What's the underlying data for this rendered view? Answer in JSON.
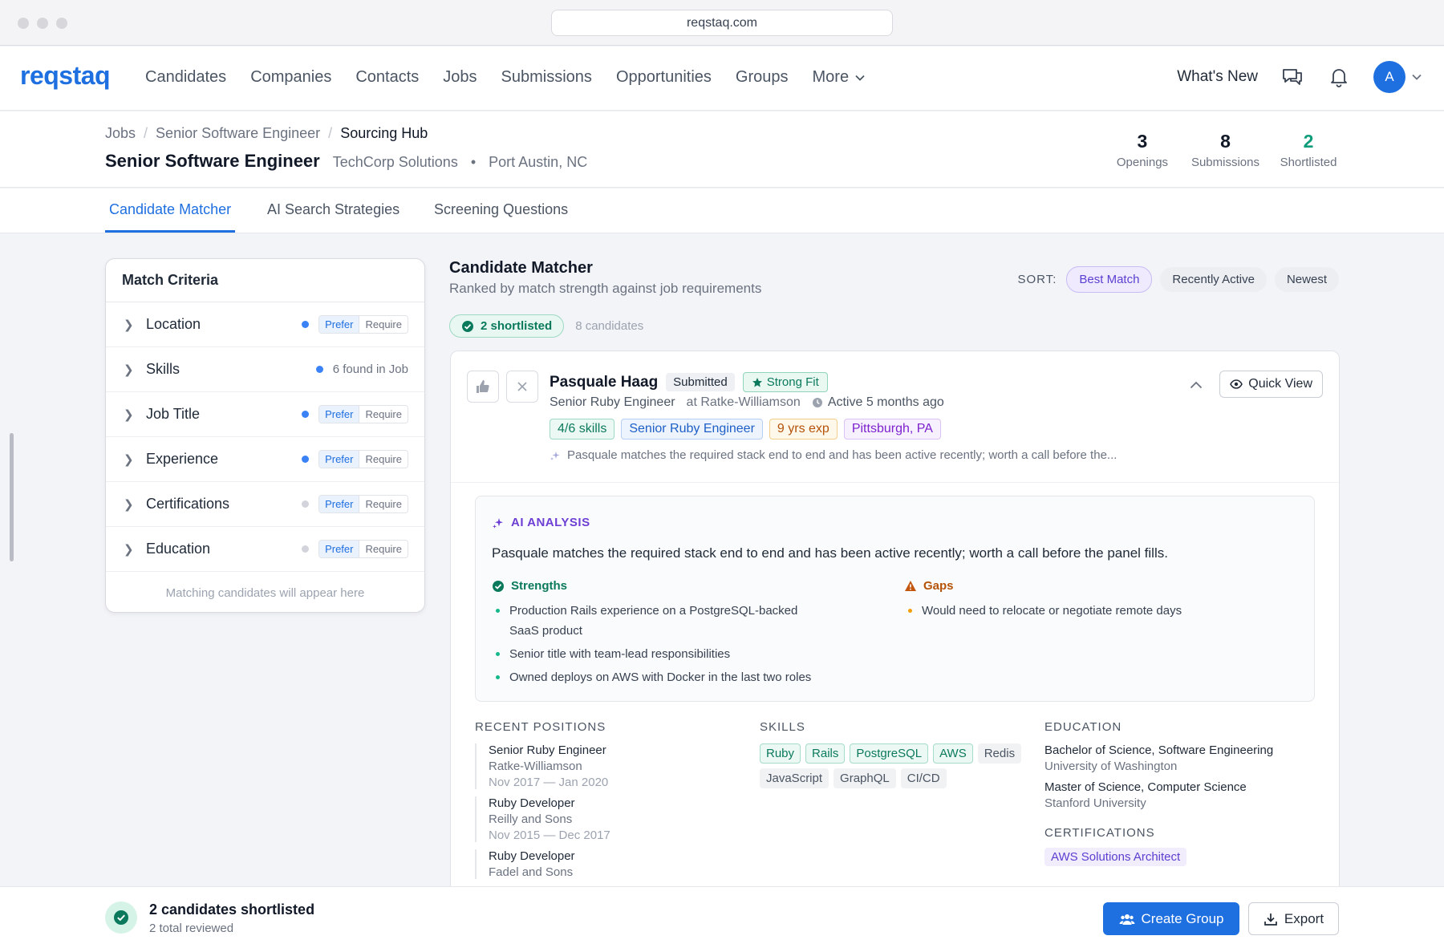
{
  "browser": {
    "url": "reqstaq.com"
  },
  "nav": {
    "logo": "reqstaq",
    "links": [
      "Candidates",
      "Companies",
      "Contacts",
      "Jobs",
      "Submissions",
      "Opportunities",
      "Groups"
    ],
    "more": "More",
    "whats_new": "What's New",
    "avatar_initial": "A"
  },
  "breadcrumb": {
    "jobs": "Jobs",
    "job": "Senior Software Engineer",
    "current": "Sourcing Hub"
  },
  "job": {
    "title": "Senior Software Engineer",
    "company": "TechCorp Solutions",
    "location": "Port Austin, NC"
  },
  "stats": [
    {
      "value": "3",
      "label": "Openings"
    },
    {
      "value": "8",
      "label": "Submissions"
    },
    {
      "value": "2",
      "label": "Shortlisted"
    }
  ],
  "tabs": [
    "Candidate Matcher",
    "AI Search Strategies",
    "Screening Questions"
  ],
  "criteria": {
    "title": "Match Criteria",
    "prefer": "Prefer",
    "require": "Require",
    "rows": [
      {
        "label": "Location"
      },
      {
        "label": "Skills",
        "found": "6 found in Job"
      },
      {
        "label": "Job Title"
      },
      {
        "label": "Experience"
      },
      {
        "label": "Certifications"
      },
      {
        "label": "Education"
      }
    ],
    "footer": "Matching candidates will appear here"
  },
  "matcher": {
    "title": "Candidate Matcher",
    "subtitle": "Ranked by match strength against job requirements",
    "sort_label": "SORT:",
    "sort_options": [
      "Best Match",
      "Recently Active",
      "Newest"
    ],
    "shortlisted": "2 shortlisted",
    "count": "8 candidates"
  },
  "candidate": {
    "name": "Pasquale Haag",
    "status": "Submitted",
    "fit": "Strong Fit",
    "role": "Senior Ruby Engineer",
    "company": "at Ratke-Williamson",
    "active": "Active 5 months ago",
    "tags": [
      "4/6 skills",
      "Senior Ruby Engineer",
      "9 yrs exp",
      "Pittsburgh, PA"
    ],
    "snippet": "Pasquale matches the required stack end to end and has been active recently; worth a call before the...",
    "quick_view": "Quick View",
    "ai": {
      "heading": "AI ANALYSIS",
      "summary": "Pasquale matches the required stack end to end and has been active recently; worth a call before the panel fills.",
      "strengths_label": "Strengths",
      "strengths": [
        "Production Rails experience on a PostgreSQL-backed SaaS product",
        "Senior title with team-lead responsibilities",
        "Owned deploys on AWS with Docker in the last two roles"
      ],
      "gaps_label": "Gaps",
      "gaps": [
        "Would need to relocate or negotiate remote days"
      ]
    },
    "positions_label": "RECENT POSITIONS",
    "positions": [
      {
        "title": "Senior Ruby Engineer",
        "company": "Ratke-Williamson",
        "dates": "Nov 2017 — Jan 2020"
      },
      {
        "title": "Ruby Developer",
        "company": "Reilly and Sons",
        "dates": "Nov 2015 — Dec 2017"
      },
      {
        "title": "Ruby Developer",
        "company": "Fadel and Sons",
        "dates": ""
      }
    ],
    "skills_label": "SKILLS",
    "skills_matched": [
      "Ruby",
      "Rails",
      "PostgreSQL",
      "AWS"
    ],
    "skills_other": [
      "Redis",
      "JavaScript",
      "GraphQL",
      "CI/CD"
    ],
    "education_label": "EDUCATION",
    "education": [
      {
        "degree": "Bachelor of Science, Software Engineering",
        "school": "University of Washington"
      },
      {
        "degree": "Master of Science, Computer Science",
        "school": "Stanford University"
      }
    ],
    "certifications_label": "CERTIFICATIONS",
    "certifications": [
      "AWS Solutions Architect"
    ]
  },
  "bottom": {
    "title": "2 candidates shortlisted",
    "sub": "2 total reviewed",
    "create_group": "Create Group",
    "export": "Export"
  },
  "colors": {
    "accent": "#1e6fe0",
    "success": "#0f9d7a",
    "ai": "#6d3fd4",
    "warning": "#b45309"
  }
}
